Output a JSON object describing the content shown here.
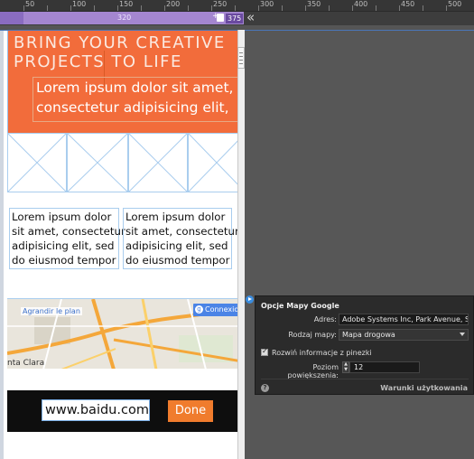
{
  "ruler": {
    "ticks": [
      "50",
      "100",
      "150",
      "200",
      "250",
      "300",
      "350",
      "400",
      "450",
      "500"
    ],
    "media_query_label": "320",
    "media_query_end": "375"
  },
  "hero": {
    "title_line1": "BRING YOUR CREATIVE",
    "title_line2": "PROJECTS TO LIFE",
    "subtitle_line1": "Lorem ipsum dolor sit amet,",
    "subtitle_line2": "consectetur adipisicing elit,"
  },
  "columns": [
    {
      "lines": [
        "Lorem ipsum dolor",
        "sit amet, consectetur",
        "adipisicing elit, sed",
        "do eiusmod tempor"
      ]
    },
    {
      "lines": [
        "Lorem ipsum dolor",
        "sit amet, consectetur",
        "adipisicing elit, sed",
        "do eiusmod tempor"
      ]
    }
  ],
  "map": {
    "enlarge_link": "Agrandir le plan",
    "connect_button": "Connexion",
    "place_label": "nta Clara"
  },
  "footer": {
    "url_value": "www.baidu.com",
    "done_label": "Done"
  },
  "panel": {
    "title": "Opcje Mapy Google",
    "address_label": "Adres:",
    "address_value": "Adobe Systems Inc, Park Avenue, San Jo",
    "map_type_label": "Rodzaj mapy:",
    "map_type_value": "Mapa drogowa",
    "expand_pin_label": "Rozwiń informacje z pinezki",
    "expand_pin_checked": true,
    "zoom_label": "Poziom powiększenia:",
    "zoom_value": "12",
    "terms_link": "Warunki użytkowania"
  },
  "colors": {
    "hero_bg": "#f26c3b",
    "media_query_bar": "#a486d0",
    "done_button": "#f07c2d",
    "panel_bg": "#2b2b2b"
  }
}
